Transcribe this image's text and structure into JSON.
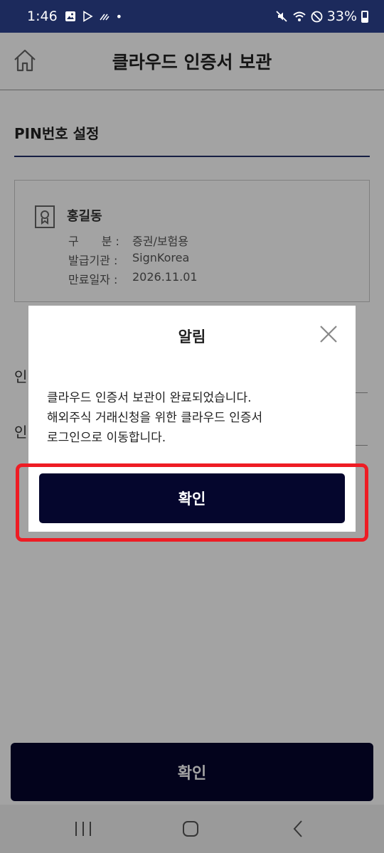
{
  "status_bar": {
    "time": "1:46",
    "battery": "33%",
    "dot": "•"
  },
  "header": {
    "title": "클라우드 인증서 보관",
    "home_icon": "home-icon"
  },
  "section": {
    "title": "PIN번호 설정"
  },
  "certificate": {
    "icon": "certificate-icon",
    "name": "홍길동",
    "rows": [
      {
        "label": "구　　분 :",
        "value": "증권/보험용"
      },
      {
        "label": "발급기관 :",
        "value": "SignKorea"
      },
      {
        "label": "만료일자 :",
        "value": "2026.11.01"
      }
    ]
  },
  "background_fields": {
    "label_1": "인",
    "label_2": "인"
  },
  "bottom_button": {
    "label": "확인"
  },
  "modal": {
    "title": "알림",
    "message_lines": [
      "클라우드 인증서 보관이 완료되었습니다.",
      "해외주식 거래신청을 위한 클라우드 인증서",
      "로그인으로 이동합니다."
    ],
    "confirm_label": "확인",
    "close_icon": "close-icon"
  },
  "colors": {
    "status_bar": "#1c2a5c",
    "primary_button": "#05062d",
    "highlight": "#ee1c24",
    "section_line": "#22306a"
  }
}
